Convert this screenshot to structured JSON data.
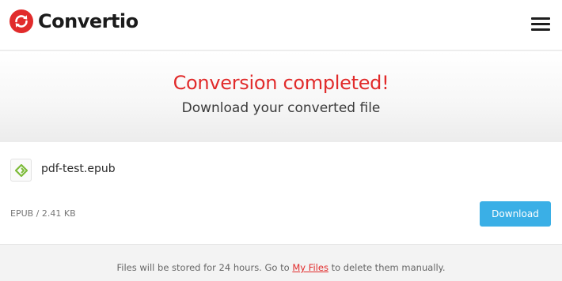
{
  "header": {
    "brand": "Convertio",
    "logo_icon": "convertio-logo-icon",
    "menu_icon": "hamburger-menu-icon"
  },
  "hero": {
    "title": "Conversion completed!",
    "subtitle": "Download your converted file"
  },
  "file": {
    "icon": "epub-file-icon",
    "name": "pdf-test.epub",
    "meta": "EPUB / 2.41 KB",
    "download_label": "Download"
  },
  "footer": {
    "text_before": "Files will be stored for 24 hours. Go to ",
    "link_label": "My Files",
    "text_after": " to delete them manually."
  },
  "colors": {
    "brand_red": "#e12b2b",
    "download_blue": "#3aafe6",
    "epub_green": "#7dbb3a"
  }
}
